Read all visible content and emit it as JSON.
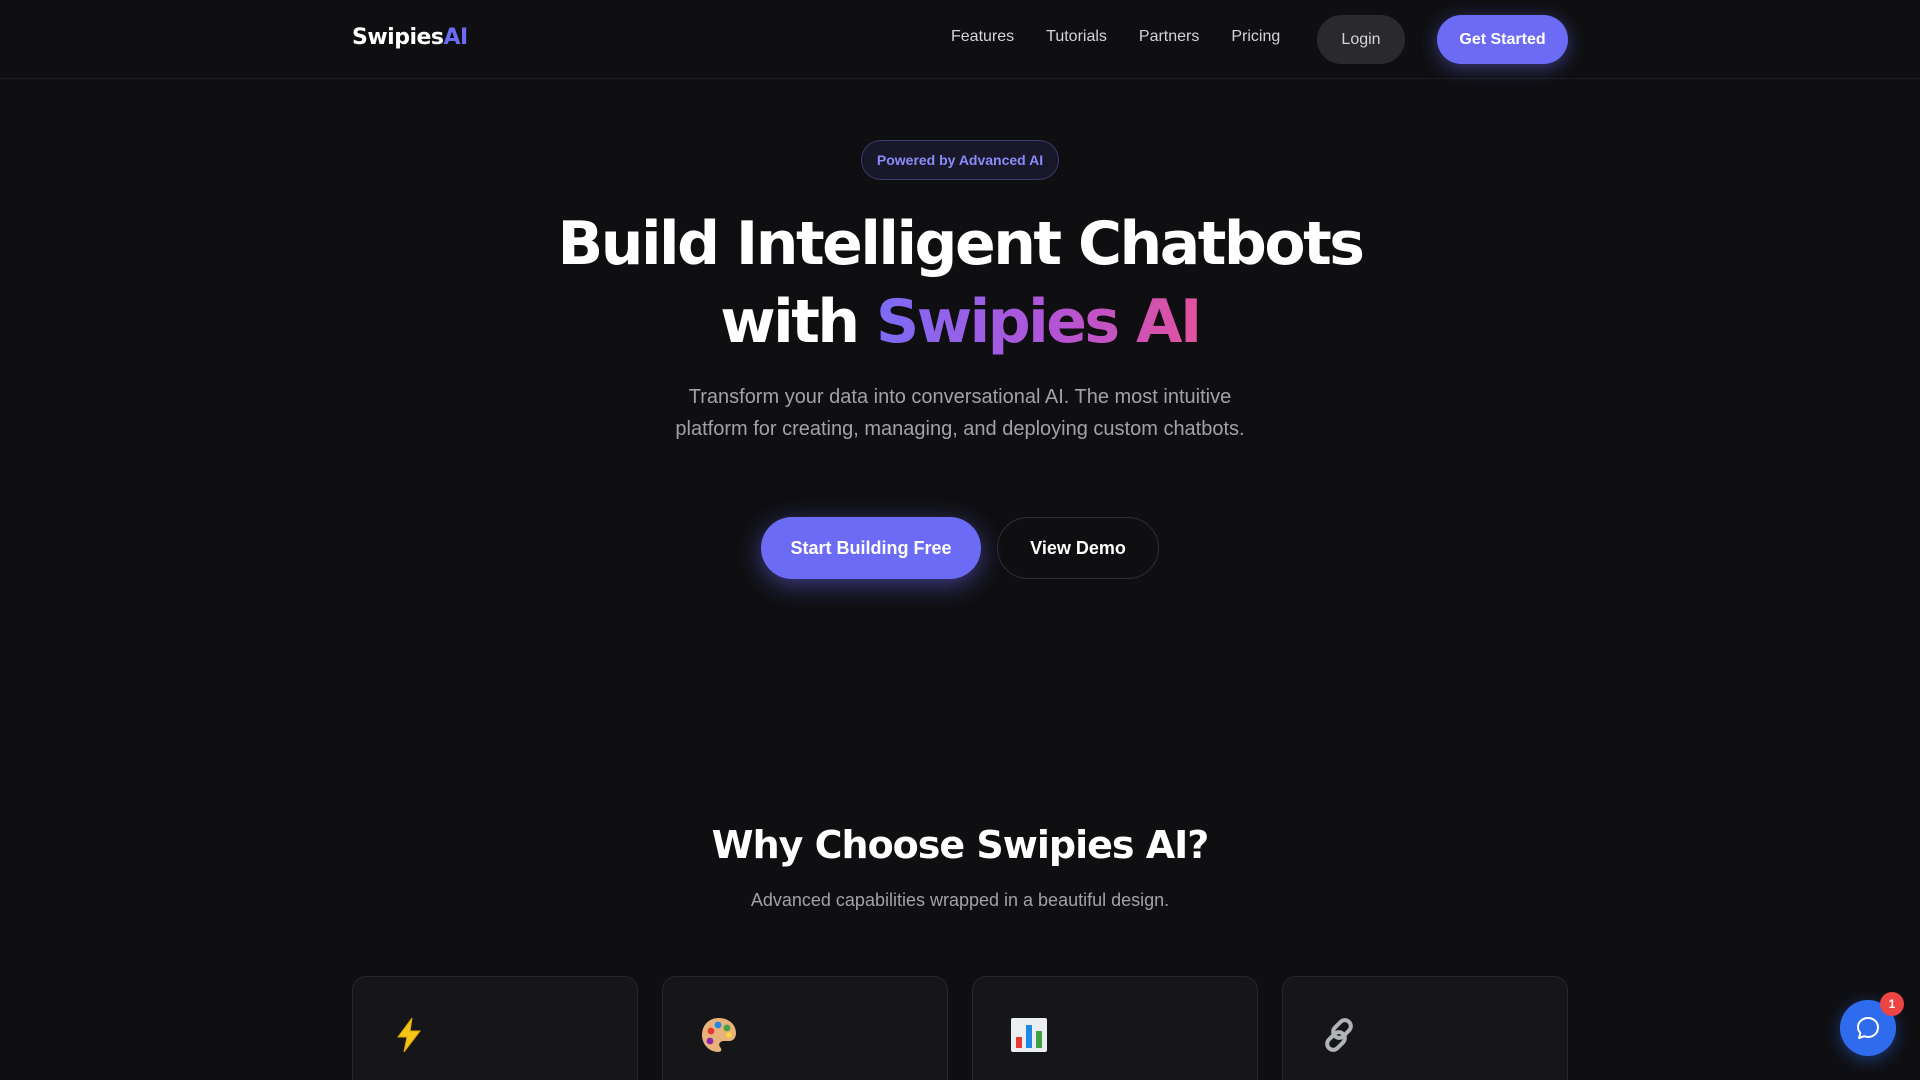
{
  "brand": {
    "name_main": "Swipies",
    "name_accent": "AI",
    "accent_color": "#6b6bf5"
  },
  "nav": {
    "links": [
      "Features",
      "Tutorials",
      "Partners",
      "Pricing"
    ],
    "login_label": "Login",
    "get_started_label": "Get Started"
  },
  "hero": {
    "badge": "Powered by Advanced AI",
    "title_line1": "Build Intelligent Chatbots",
    "title_line2_prefix": "with",
    "title_line2_highlight": "Swipies AI",
    "subtitle": "Transform your data into conversational AI. The most intuitive platform for creating, managing, and deploying custom chatbots.",
    "primary_cta": "Start Building Free",
    "secondary_cta": "View Demo"
  },
  "why": {
    "title": "Why Choose Swipies AI?",
    "subtitle": "Advanced capabilities wrapped in a beautiful design.",
    "cards": [
      {
        "icon": "lightning-icon"
      },
      {
        "icon": "palette-icon"
      },
      {
        "icon": "bar-chart-icon"
      },
      {
        "icon": "link-icon"
      }
    ]
  },
  "chat_widget": {
    "icon": "chat-icon",
    "unread_count": "1",
    "color": "#2f6bed"
  }
}
